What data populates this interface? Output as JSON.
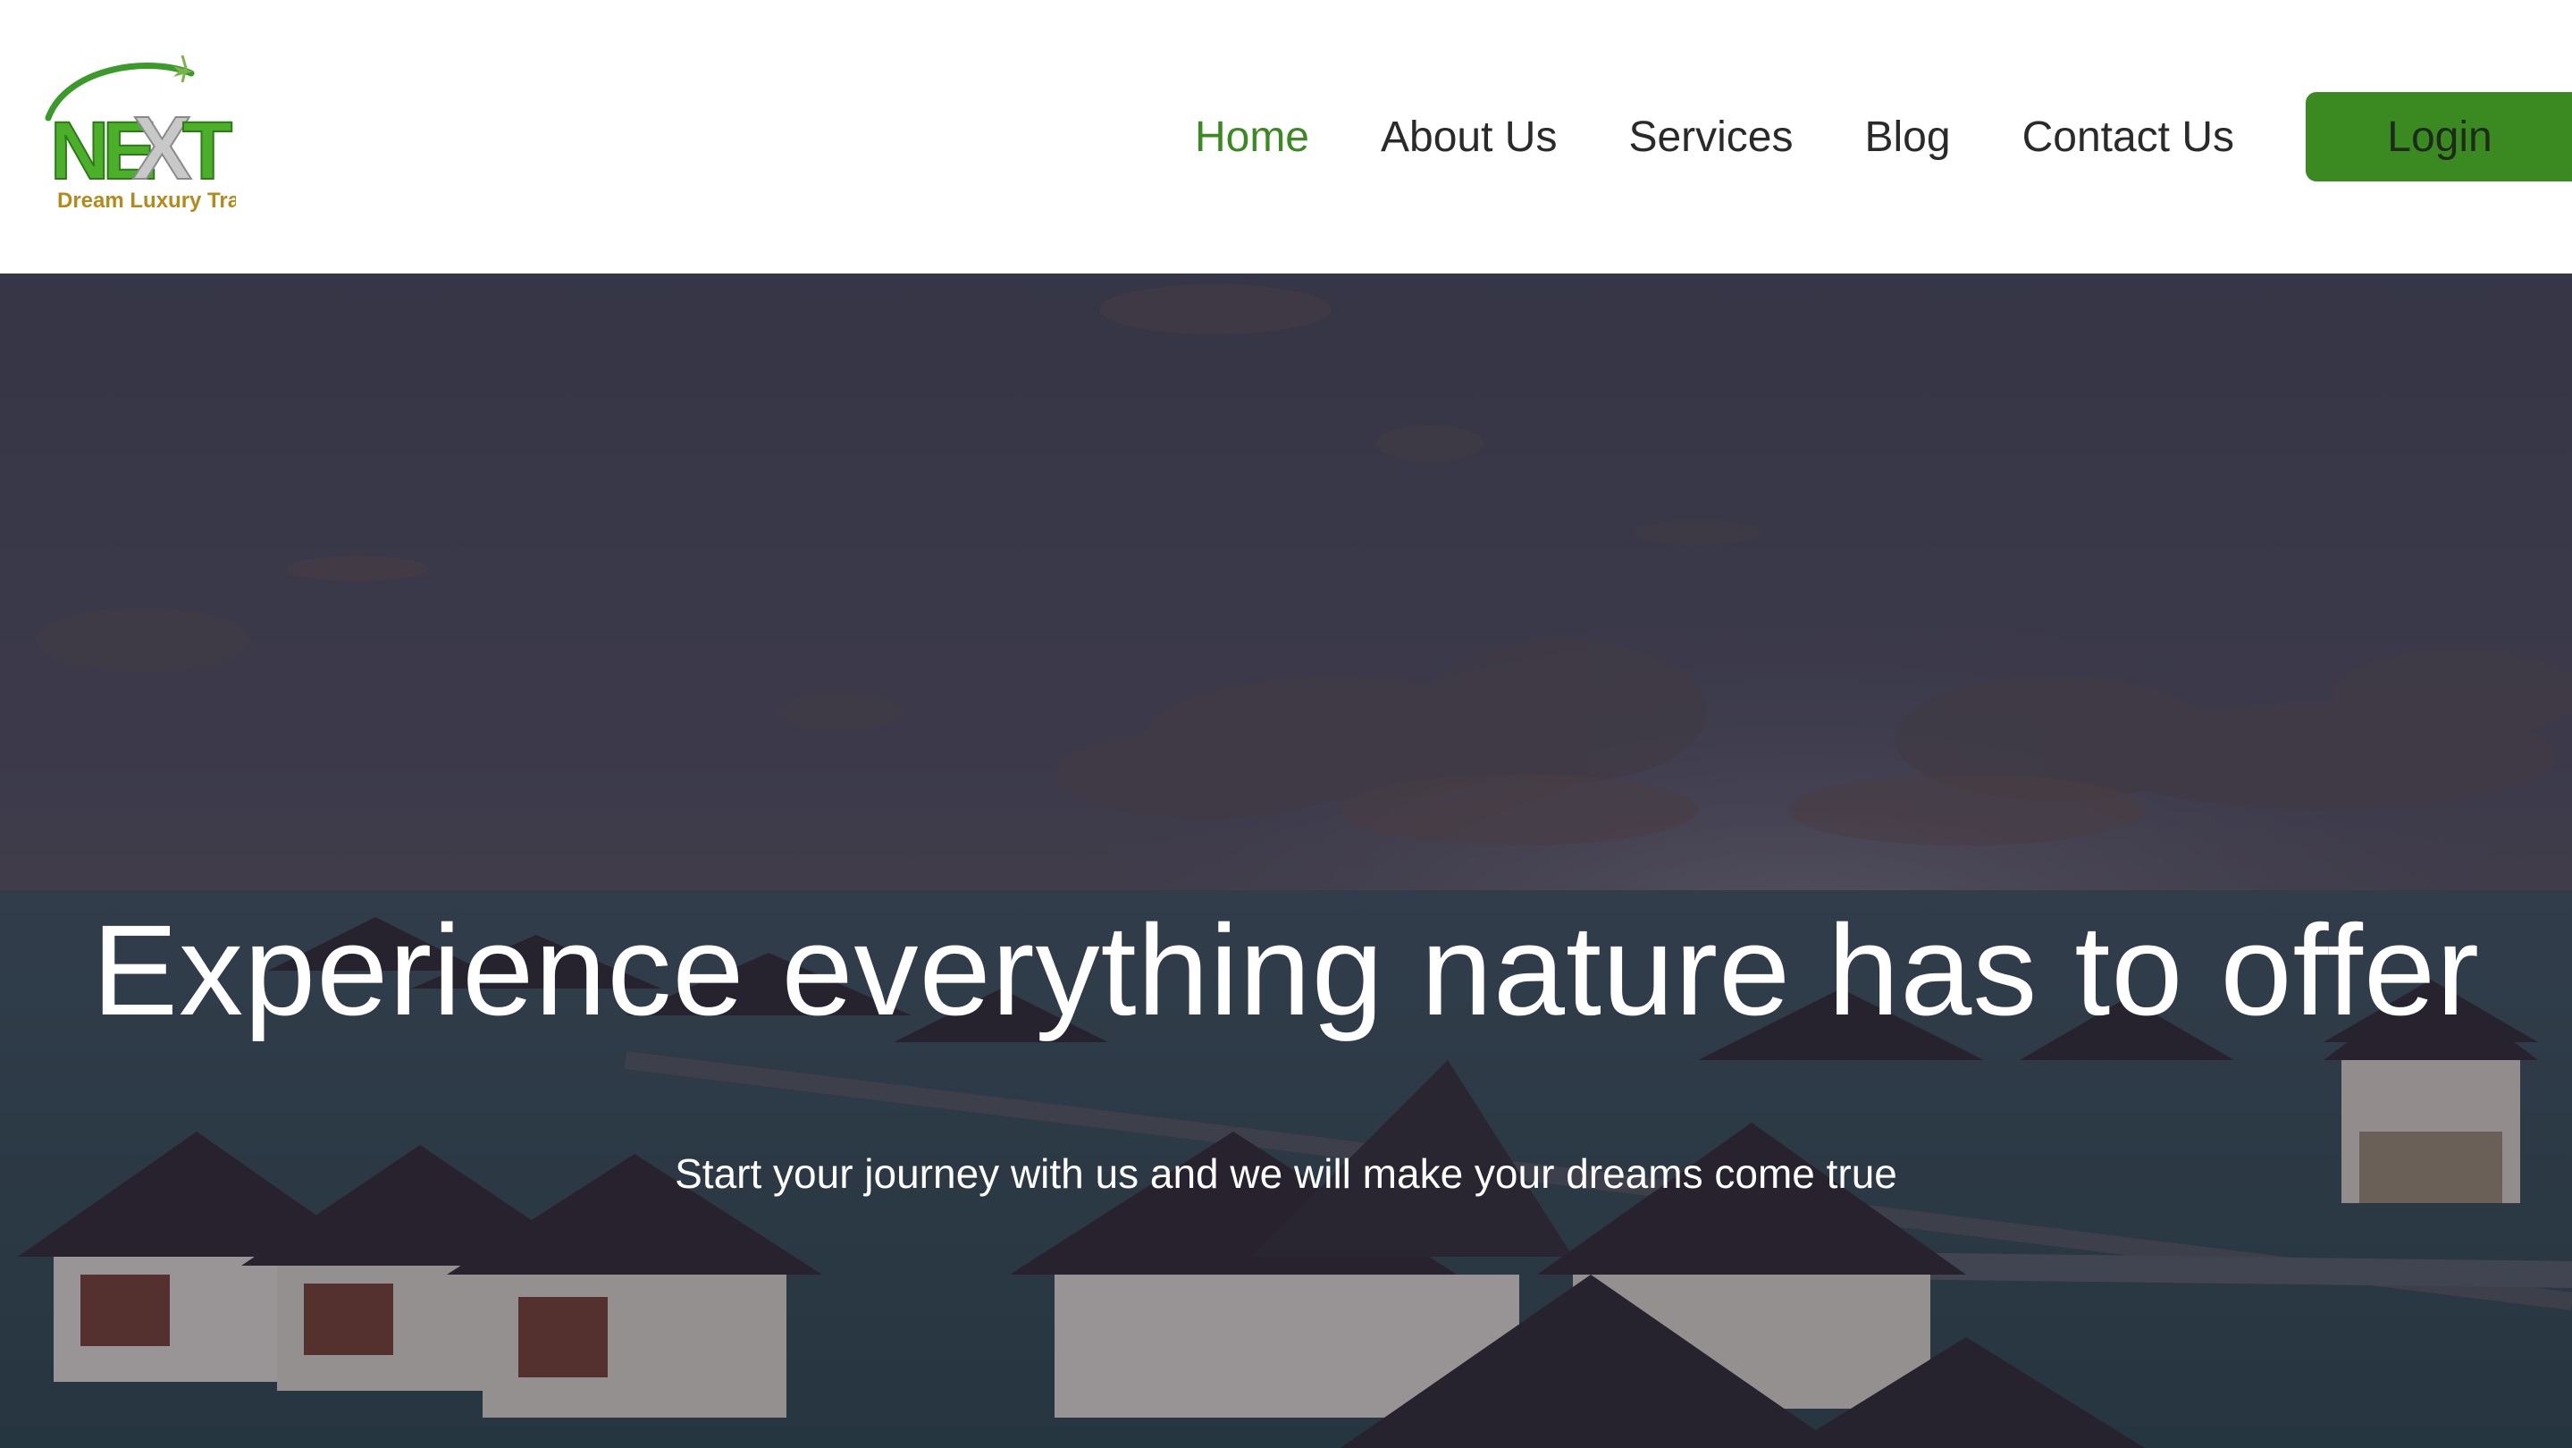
{
  "brand": {
    "logo_text": "NEXT",
    "tagline": "Dream Luxury Travels"
  },
  "nav": {
    "items": [
      {
        "label": "Home",
        "active": true
      },
      {
        "label": "About Us",
        "active": false
      },
      {
        "label": "Services",
        "active": false
      },
      {
        "label": "Blog",
        "active": false
      },
      {
        "label": "Contact Us",
        "active": false
      }
    ],
    "login_label": "Login"
  },
  "hero": {
    "title": "Experience everything nature has to offer",
    "subtitle": "Start your journey with us and we will make your dreams come true"
  },
  "colors": {
    "accent": "#3a8a21",
    "nav_text": "#2a2a2a",
    "header_bg": "#ffffff",
    "hero_overlay": "#2a2c3a"
  }
}
